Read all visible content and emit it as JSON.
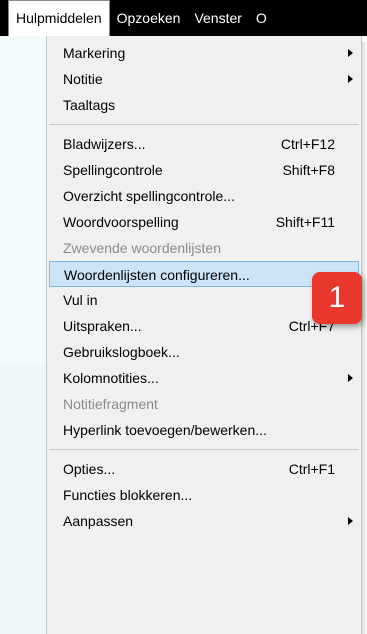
{
  "menubar": {
    "items": [
      "Hulpmiddelen",
      "Opzoeken",
      "Venster",
      "O"
    ]
  },
  "menu": {
    "groups": [
      [
        {
          "label": "Markering",
          "submenu": true
        },
        {
          "label": "Notitie",
          "submenu": true
        },
        {
          "label": "Taaltags"
        }
      ],
      [
        {
          "label": "Bladwijzers...",
          "shortcut": "Ctrl+F12"
        },
        {
          "label": "Spellingcontrole",
          "shortcut": "Shift+F8"
        },
        {
          "label": "Overzicht spellingcontrole..."
        },
        {
          "label": "Woordvoorspelling",
          "shortcut": "Shift+F11"
        },
        {
          "label": "Zwevende woordenlijsten",
          "disabled": true
        },
        {
          "label": "Woordenlijsten configureren...",
          "highlighted": true
        },
        {
          "label": "Vul in"
        },
        {
          "label": "Uitspraken...",
          "shortcut": "Ctrl+F7"
        },
        {
          "label": "Gebruikslogboek..."
        },
        {
          "label": "Kolomnotities...",
          "submenu": true
        },
        {
          "label": "Notitiefragment",
          "disabled": true
        },
        {
          "label": "Hyperlink toevoegen/bewerken..."
        }
      ],
      [
        {
          "label": "Opties...",
          "shortcut": "Ctrl+F1"
        },
        {
          "label": "Functies blokkeren..."
        },
        {
          "label": "Aanpassen",
          "submenu": true
        }
      ]
    ]
  },
  "badge": {
    "number": "1"
  },
  "colors": {
    "highlight": "#cce4f7",
    "badge": "#e8372c",
    "disabled": "#8a8a8a",
    "menubar": "#000000"
  }
}
